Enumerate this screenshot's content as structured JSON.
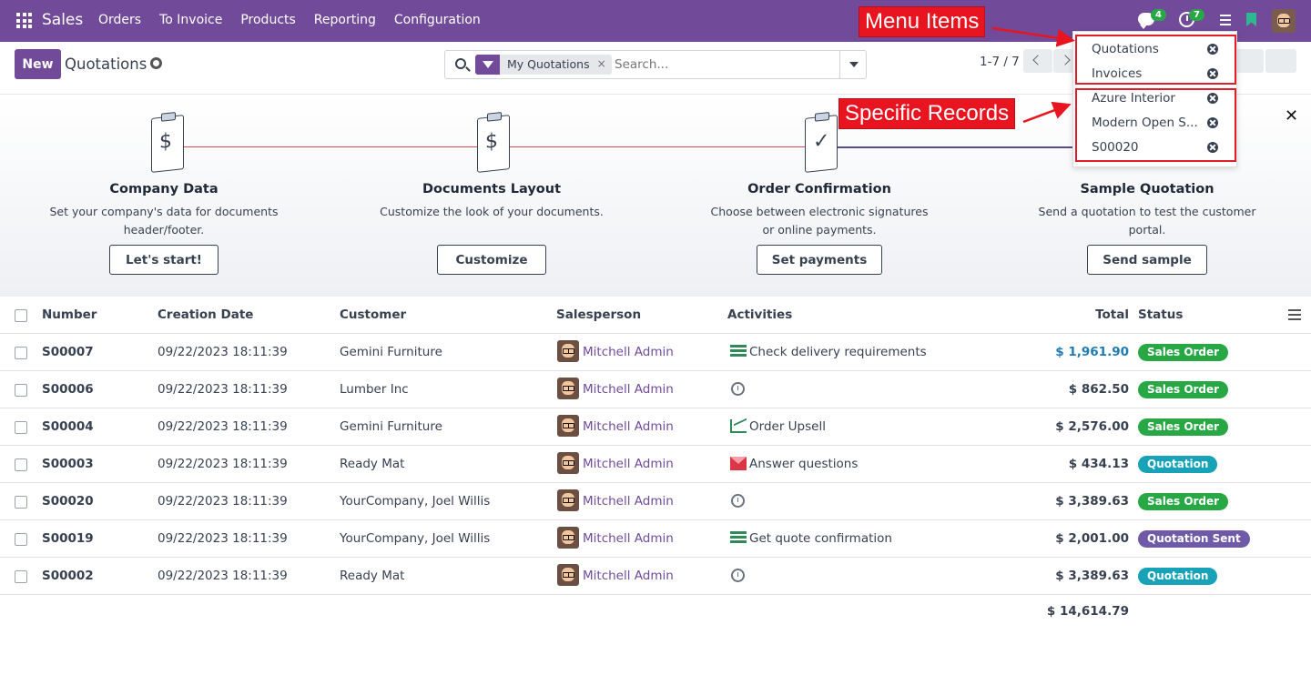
{
  "navbar": {
    "brand": "Sales",
    "menu": [
      "Orders",
      "To Invoice",
      "Products",
      "Reporting",
      "Configuration"
    ],
    "chat_count": "4",
    "activity_count": "7",
    "brand_color": "#714b9a"
  },
  "control_panel": {
    "new_label": "New",
    "title": "Quotations",
    "facet": "My Quotations",
    "search_placeholder": "Search...",
    "pager": "1-7 / 7"
  },
  "dropdown": {
    "menu_items": [
      "Quotations",
      "Invoices"
    ],
    "records": [
      "Azure Interior",
      "Modern Open S...",
      "S00020"
    ]
  },
  "annotations": {
    "menu_items_label": "Menu Items",
    "records_label": "Specific Records",
    "color": "#e8141f"
  },
  "onboarding": {
    "steps": [
      {
        "title": "Company Data",
        "desc1": "Set your company's data for documents",
        "desc2": "header/footer.",
        "button": "Let's start!"
      },
      {
        "title": "Documents Layout",
        "desc1": "Customize the look of your documents.",
        "desc2": "",
        "button": "Customize"
      },
      {
        "title": "Order Confirmation",
        "desc1": "Choose between electronic signatures",
        "desc2": "or online payments.",
        "button": "Set payments"
      },
      {
        "title": "Sample Quotation",
        "desc1": "Send a quotation to test the customer",
        "desc2": "portal.",
        "button": "Send sample"
      }
    ]
  },
  "table": {
    "headers": {
      "number": "Number",
      "date": "Creation Date",
      "customer": "Customer",
      "salesperson": "Salesperson",
      "activities": "Activities",
      "total": "Total",
      "status": "Status"
    },
    "rows": [
      {
        "number": "S00007",
        "date": "09/22/2023 18:11:39",
        "customer": "Gemini Furniture",
        "salesperson": "Mitchell Admin",
        "activity": "Check delivery requirements",
        "activity_icon": "task-icon",
        "total": "$ 1,961.90",
        "status": "Sales Order",
        "status_color": "#28a745"
      },
      {
        "number": "S00006",
        "date": "09/22/2023 18:11:39",
        "customer": "Lumber Inc",
        "salesperson": "Mitchell Admin",
        "activity": "",
        "activity_icon": "clock-icon",
        "total": "$ 862.50",
        "status": "Sales Order",
        "status_color": "#28a745"
      },
      {
        "number": "S00004",
        "date": "09/22/2023 18:11:39",
        "customer": "Gemini Furniture",
        "salesperson": "Mitchell Admin",
        "activity": "Order Upsell",
        "activity_icon": "upsell-icon",
        "total": "$ 2,576.00",
        "status": "Sales Order",
        "status_color": "#28a745"
      },
      {
        "number": "S00003",
        "date": "09/22/2023 18:11:39",
        "customer": "Ready Mat",
        "salesperson": "Mitchell Admin",
        "activity": "Answer questions",
        "activity_icon": "mail-icon",
        "total": "$ 434.13",
        "status": "Quotation",
        "status_color": "#17a2b8"
      },
      {
        "number": "S00020",
        "date": "09/22/2023 18:11:39",
        "customer": "YourCompany, Joel Willis",
        "salesperson": "Mitchell Admin",
        "activity": "",
        "activity_icon": "clock-icon",
        "total": "$ 3,389.63",
        "status": "Sales Order",
        "status_color": "#28a745"
      },
      {
        "number": "S00019",
        "date": "09/22/2023 18:11:39",
        "customer": "YourCompany, Joel Willis",
        "salesperson": "Mitchell Admin",
        "activity": "Get quote confirmation",
        "activity_icon": "task-icon",
        "total": "$ 2,001.00",
        "status": "Quotation Sent",
        "status_color": "#6f5aa8"
      },
      {
        "number": "S00002",
        "date": "09/22/2023 18:11:39",
        "customer": "Ready Mat",
        "salesperson": "Mitchell Admin",
        "activity": "",
        "activity_icon": "clock-icon",
        "total": "$ 3,389.63",
        "status": "Quotation",
        "status_color": "#17a2b8"
      }
    ],
    "grand_total": "$ 14,614.79"
  }
}
